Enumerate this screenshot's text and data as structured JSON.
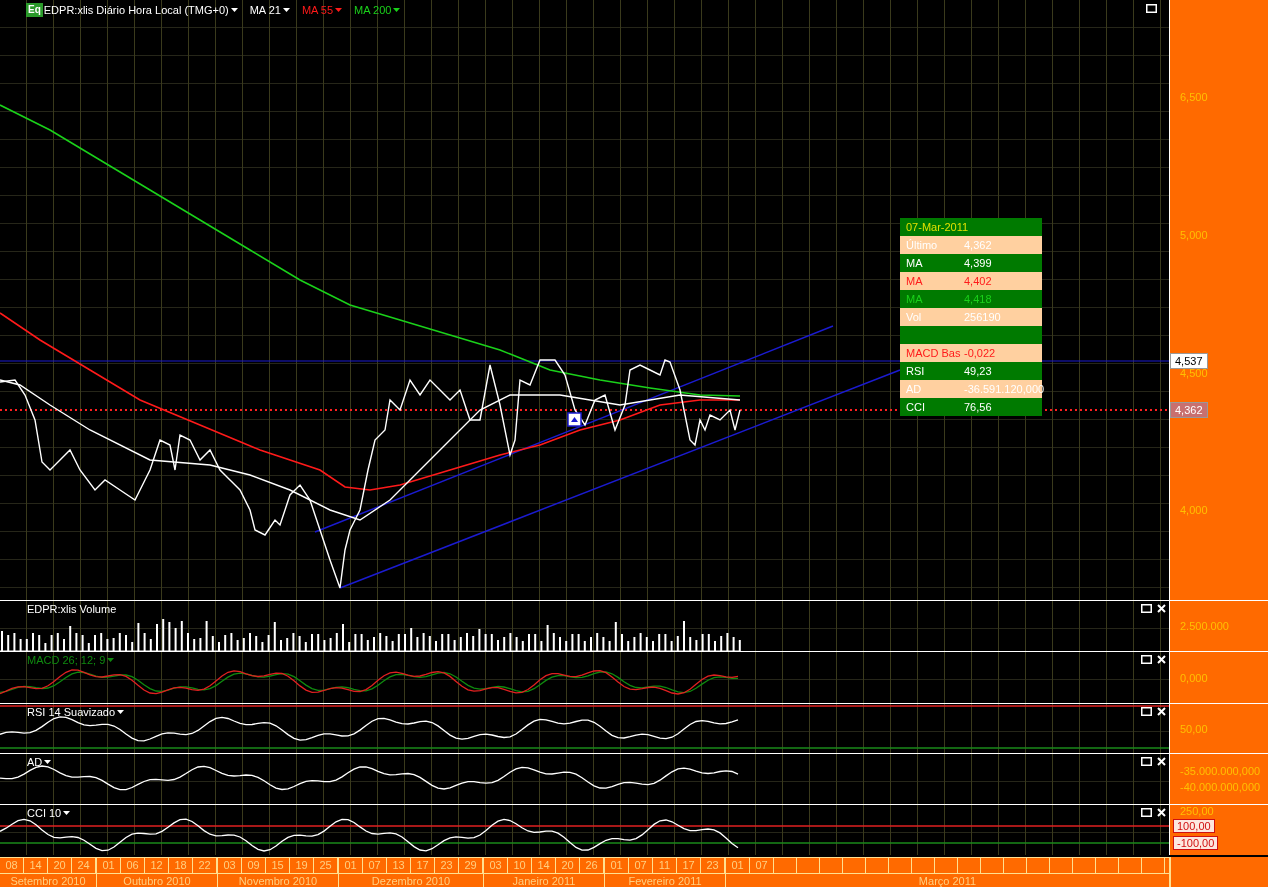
{
  "header": {
    "badge": "Eq",
    "title": "EDPR:xlis Diário Hora Local (TMG+0)",
    "studies": [
      {
        "label": "MA 21",
        "color": "#ffffff"
      },
      {
        "label": "MA 55",
        "color": "#ff1a1a"
      },
      {
        "label": "MA 200",
        "color": "#1ad11a"
      }
    ]
  },
  "price_axis": {
    "ticks": [
      "6,500",
      "5,000",
      "4,500",
      "4,000"
    ],
    "markers": [
      {
        "label": "4,537",
        "kind": "line"
      },
      {
        "label": "4,362",
        "kind": "last"
      }
    ]
  },
  "data_box": {
    "date": "07-Mar-2011",
    "rows": [
      {
        "kind": "value",
        "label": "Último",
        "value": "4,362",
        "color": "#ffffff"
      },
      {
        "kind": "value",
        "label": "MA",
        "value": "4,399",
        "color": "#ffffff"
      },
      {
        "kind": "value",
        "label": "MA",
        "value": "4,402",
        "color": "#ff1a1a"
      },
      {
        "kind": "value",
        "label": "MA",
        "value": "4,418",
        "color": "#1ad11a"
      },
      {
        "kind": "value",
        "label": "Vol",
        "value": "256190",
        "color": "#ffffff"
      },
      {
        "kind": "spacer"
      },
      {
        "kind": "value",
        "label": "MACD Bas",
        "value": "-0,022",
        "color": "#ff1a1a"
      },
      {
        "kind": "value",
        "label": "RSI",
        "value": "49,23",
        "color": "#ffffff"
      },
      {
        "kind": "value",
        "label": "AD",
        "value": "-36.591.120,000",
        "color": "#ffffff"
      },
      {
        "kind": "value",
        "label": "CCI",
        "value": "76,56",
        "color": "#ffffff"
      }
    ]
  },
  "panels": [
    {
      "kind": "volume",
      "title": "EDPR:xlis Volume",
      "color": "#ffffff",
      "has_menu": false,
      "ticks": [
        "2.500.000"
      ]
    },
    {
      "kind": "macd",
      "title": "MACD 26; 12; 9",
      "color": "#0f8a0f",
      "has_menu": true,
      "ticks": [
        "0,000"
      ]
    },
    {
      "kind": "rsi",
      "title": "RSI 14 Suavizado",
      "color": "#ffffff",
      "has_menu": true,
      "ticks": [
        "50,00"
      ]
    },
    {
      "kind": "ad",
      "title": "AD",
      "color": "#ffffff",
      "has_menu": true,
      "ticks": [
        "-35.000.000,000",
        "-40.000.000,000"
      ]
    },
    {
      "kind": "cci",
      "title": "CCI 10",
      "color": "#ffffff",
      "has_menu": true,
      "ticks": [
        "250,00"
      ],
      "levels": [
        "100,00",
        "-100,00"
      ]
    }
  ],
  "date_axis": {
    "months": [
      {
        "name": "Setembro 2010",
        "days": [
          "08",
          "14",
          "20",
          "24"
        ]
      },
      {
        "name": "Outubro 2010",
        "days": [
          "01",
          "06",
          "12",
          "18",
          "22"
        ]
      },
      {
        "name": "Novembro 2010",
        "days": [
          "03",
          "09",
          "15",
          "19",
          "25"
        ]
      },
      {
        "name": "Dezembro 2010",
        "days": [
          "01",
          "07",
          "13",
          "17",
          "23",
          "29"
        ]
      },
      {
        "name": "Janeiro 2011",
        "days": [
          "03",
          "10",
          "14",
          "20",
          "26"
        ]
      },
      {
        "name": "Fevereiro 2011",
        "days": [
          "01",
          "07",
          "11",
          "17",
          "23"
        ]
      },
      {
        "name": "Março 2011",
        "days": [
          "01",
          "07"
        ]
      }
    ]
  }
}
